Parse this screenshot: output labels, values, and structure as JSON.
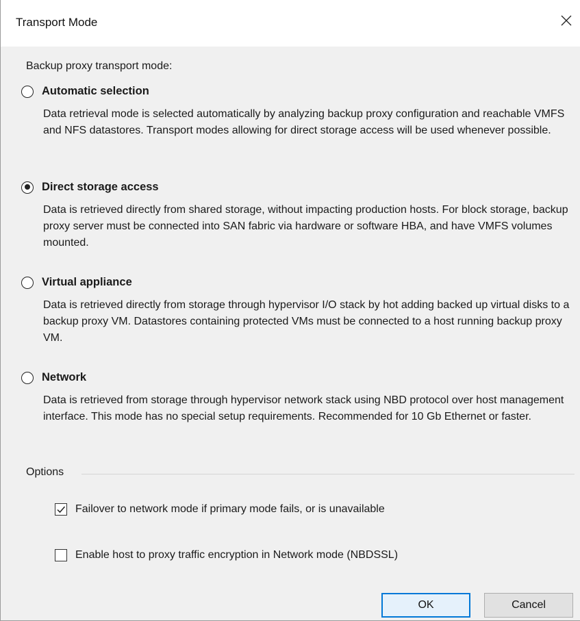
{
  "window": {
    "title": "Transport Mode"
  },
  "transport": {
    "intro": "Backup proxy transport mode:",
    "selected": "Direct storage access",
    "options": [
      {
        "label": "Automatic selection",
        "desc": "Data retrieval mode is selected automatically by analyzing backup proxy configuration and reachable VMFS and NFS datastores. Transport modes allowing for direct storage access will be used whenever possible.",
        "checked": false
      },
      {
        "label": "Direct storage access",
        "desc": "Data is retrieved directly from shared storage, without impacting production hosts. For block storage, backup proxy server must be connected into SAN fabric via hardware or software HBA, and have VMFS volumes mounted.",
        "checked": true
      },
      {
        "label": "Virtual appliance",
        "desc": "Data is retrieved directly from storage through hypervisor I/O stack by hot adding backed up virtual disks to a backup proxy VM. Datastores containing protected VMs must be connected to a host running backup proxy VM.",
        "checked": false
      },
      {
        "label": "Network",
        "desc": "Data is retrieved from storage through hypervisor network stack using NBD protocol over host management interface. This mode has no special setup requirements. Recommended for 10 Gb Ethernet or faster.",
        "checked": false
      }
    ]
  },
  "options": {
    "legend": "Options",
    "checks": [
      {
        "label": "Failover to network mode if primary mode fails, or is unavailable",
        "checked": true
      },
      {
        "label": "Enable host to proxy traffic encryption in Network mode (NBDSSL)",
        "checked": false
      }
    ]
  },
  "buttons": {
    "ok": "OK",
    "cancel": "Cancel"
  }
}
